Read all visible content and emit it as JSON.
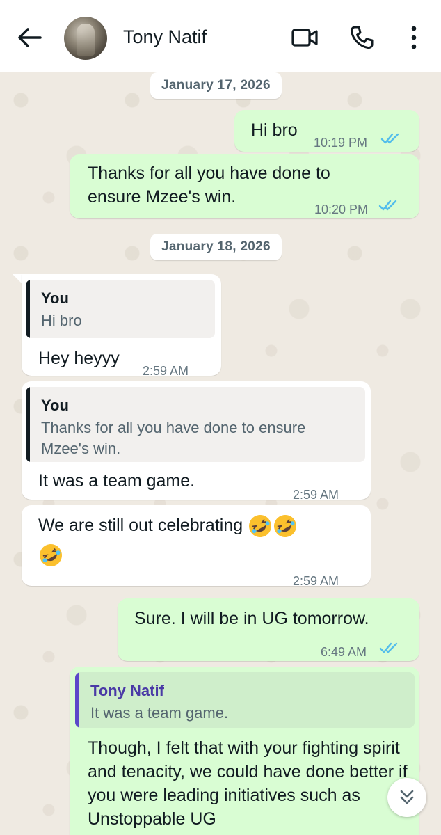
{
  "header": {
    "contact_name": "Tony Natif",
    "back_icon": "arrow-left-icon",
    "video_icon": "video-camera-icon",
    "call_icon": "phone-icon",
    "menu_icon": "more-vertical-icon"
  },
  "colors": {
    "outgoing_bubble": "#d9fdd3",
    "incoming_bubble": "#ffffff",
    "read_ticks": "#53bdeb",
    "chat_background": "#efeae2"
  },
  "dates": [
    "January 17, 2026",
    "January 18, 2026"
  ],
  "messages": [
    {
      "direction": "out",
      "text": "Hi bro",
      "time": "10:19 PM",
      "status": "read"
    },
    {
      "direction": "out",
      "text": "Thanks for all you have done to ensure Mzee's win.",
      "time": "10:20 PM",
      "status": "read"
    },
    {
      "direction": "in",
      "quote_author": "You",
      "quote_text": "Hi bro",
      "text": "Hey heyyy",
      "time": "2:59 AM"
    },
    {
      "direction": "in",
      "quote_author": "You",
      "quote_text": "Thanks for all you have done to ensure Mzee's win.",
      "text": "It was a team game.",
      "time": "2:59 AM"
    },
    {
      "direction": "in",
      "text": "We are still out celebrating",
      "emoji": "rolling-on-floor-laughing x3",
      "time": "2:59 AM"
    },
    {
      "direction": "out",
      "text": "Sure. I will be in UG tomorrow.",
      "time": "6:49 AM",
      "status": "read"
    },
    {
      "direction": "out",
      "quote_author": "Tony Natif",
      "quote_text": "It was a team game.",
      "text": "Though, I felt that with your fighting spirit and tenacity, we could have done better if you were leading initiatives such as Unstoppable UG"
    }
  ],
  "scroll_button_icon": "double-chevron-down-icon"
}
